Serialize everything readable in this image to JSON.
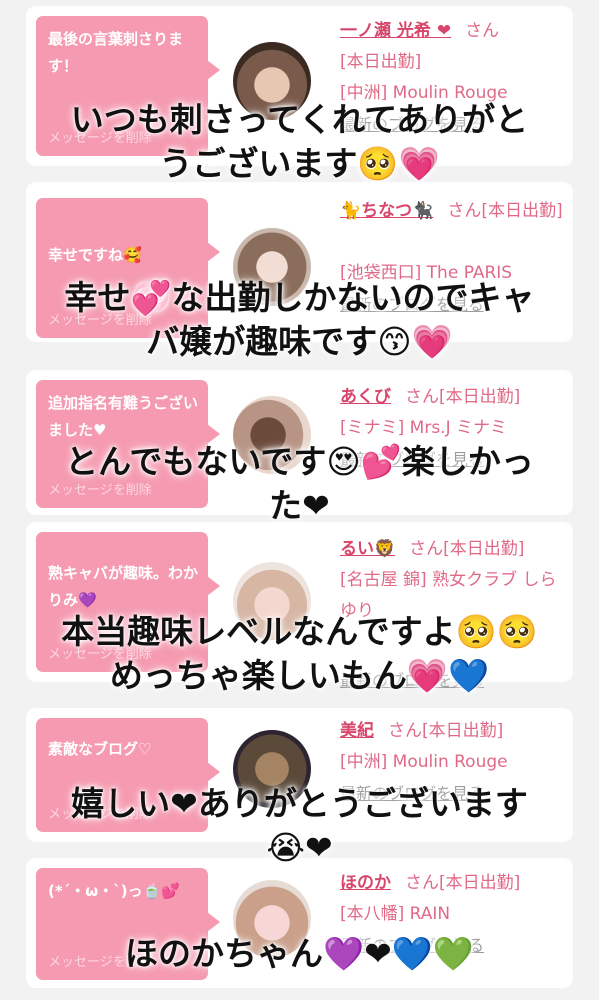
{
  "cards": [
    {
      "bubble_text": "最後の言葉刺さります！",
      "delete_label": "メッセージを削除",
      "name": "一ノ瀬 光希 ❤",
      "san": "さん",
      "status": "[本日出勤]",
      "shop": "[中洲] Moulin Rouge",
      "blog_link": "最新のブログを見る",
      "caption_lines": [
        "いつも刺さってくれてありがと",
        "うございます🥺💗"
      ]
    },
    {
      "bubble_text": "幸せですね🥰",
      "delete_label": "メッセージを削除",
      "name": "🐈ちなつ🐈‍⬛",
      "san": "さん[本日出勤]",
      "status": "",
      "shop": "[池袋西口] The PARIS",
      "blog_link": "最新のブログを見る",
      "caption_lines": [
        "幸せ💞な出勤しかないのでキャ",
        "バ嬢が趣味です😙💗"
      ]
    },
    {
      "bubble_text": "追加指名有難うございました♥",
      "delete_label": "メッセージを削除",
      "name": "あくび",
      "san": "さん[本日出勤]",
      "status": "",
      "shop": "[ミナミ] Mrs.J ミナミ",
      "blog_link": "最新のブログを見る",
      "caption_lines": [
        "とんでもないです😍💕楽しかっ",
        "た❤"
      ]
    },
    {
      "bubble_text": "熟キャバが趣味。わかりみ💜",
      "delete_label": "メッセージを削除",
      "name": "るい🦁",
      "san": "さん[本日出勤]",
      "status": "",
      "shop": "[名古屋 錦] 熟女クラブ しらゆり",
      "blog_link": "最新のブログを見る",
      "caption_lines": [
        "本当趣味レベルなんですよ🥺🥺",
        "めっちゃ楽しいもん💗💙"
      ]
    },
    {
      "bubble_text": "素敵なブログ♡",
      "delete_label": "メッセージを削除",
      "name": "美紀",
      "san": "さん[本日出勤]",
      "status": "",
      "shop": "[中洲] Moulin Rouge",
      "blog_link": "最新のブログを見る",
      "caption_lines": [
        "嬉しい❤ありがとうございます",
        "😭❤"
      ]
    },
    {
      "bubble_text": "(*´・ω・`)っ🍵💕",
      "delete_label": "メッセージを削除",
      "name": "ほのか",
      "san": "さん[本日出勤]",
      "status": "",
      "shop": "[本八幡] RAIN",
      "blog_link": "最新のブログを見る",
      "caption_lines": [
        "ほのかちゃん💜❤💙💚"
      ]
    }
  ],
  "colors": {
    "bubble": "#f59ab0",
    "name": "#d9466b",
    "info": "#e06a86",
    "background": "#f2f2f2"
  }
}
